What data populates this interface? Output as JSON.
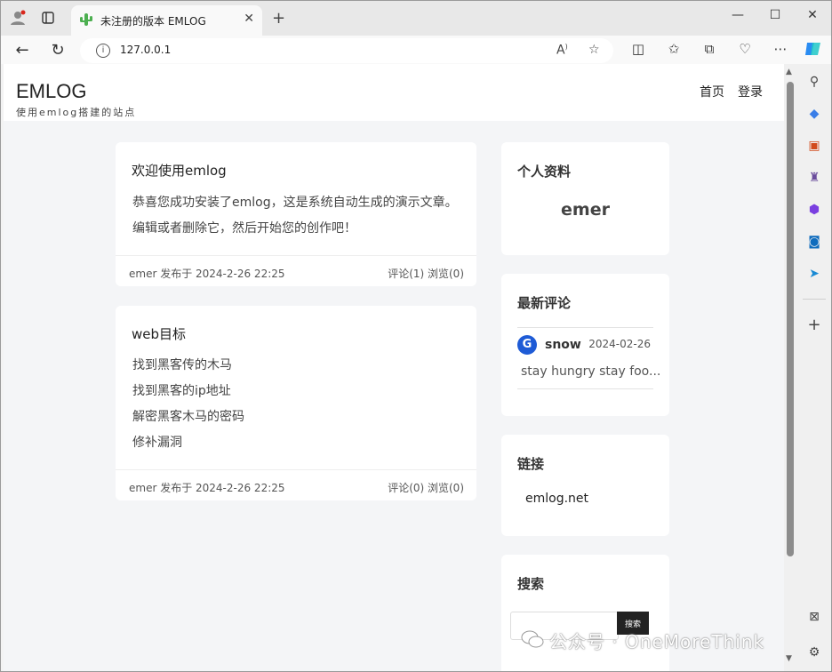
{
  "browser": {
    "tab_title": "未注册的版本 EMLOG",
    "url": "127.0.0.1",
    "new_tab": "+",
    "close": "✕"
  },
  "site": {
    "logo": "EMLOG",
    "tagline": "使用emlog搭建的站点",
    "nav": [
      {
        "label": "首页"
      },
      {
        "label": "登录"
      }
    ]
  },
  "posts": [
    {
      "title": "欢迎使用emlog",
      "lines": [
        "恭喜您成功安装了emlog，这是系统自动生成的演示文章。",
        "编辑或者删除它，然后开始您的创作吧！"
      ],
      "meta_left": "emer 发布于  2024-2-26 22:25",
      "meta_right": "评论(1)  浏览(0)"
    },
    {
      "title": "web目标",
      "lines": [
        "找到黑客传的木马",
        "找到黑客的ip地址",
        "解密黑客木马的密码",
        "修补漏洞"
      ],
      "meta_left": "emer 发布于  2024-2-26 22:25",
      "meta_right": "评论(0)  浏览(0)"
    }
  ],
  "widgets": {
    "profile": {
      "title": "个人资料",
      "name": "emer"
    },
    "comments": {
      "title": "最新评论",
      "author": "snow",
      "date": "2024-02-26",
      "text": "stay hungry stay foo..."
    },
    "links": {
      "title": "链接",
      "items": [
        "emlog.net"
      ]
    },
    "search": {
      "title": "搜索",
      "button": "搜索"
    }
  },
  "watermark": "公众号 · OneMoreThink"
}
